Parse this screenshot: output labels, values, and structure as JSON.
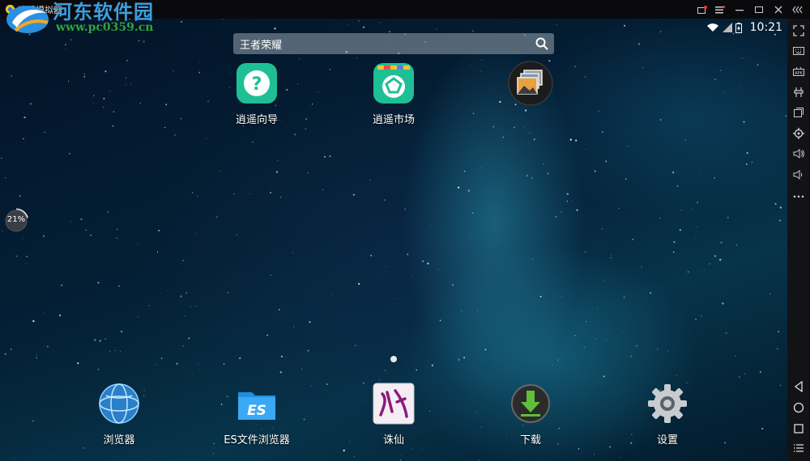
{
  "window": {
    "title": "逍遥模拟器"
  },
  "watermark": {
    "title": "河东软件园",
    "url": "www.pc0359.cn"
  },
  "status": {
    "time": "10:21"
  },
  "search": {
    "text": "王者荣耀"
  },
  "progress": {
    "percent": 21,
    "label": "21%"
  },
  "apps_top": [
    {
      "label": "逍遥向导",
      "icon": "help-icon",
      "color": "#1fbf95"
    },
    {
      "label": "逍遥市场",
      "icon": "market-icon",
      "color": "#1fbf95"
    },
    {
      "label": "",
      "icon": "gallery-icon",
      "color": "#222222"
    }
  ],
  "dock": [
    {
      "label": "浏览器",
      "icon": "browser-globe-icon"
    },
    {
      "label": "ES文件浏览器",
      "icon": "es-folder-icon"
    },
    {
      "label": "诛仙",
      "icon": "zhuxian-game-icon"
    },
    {
      "label": "下载",
      "icon": "download-icon"
    },
    {
      "label": "设置",
      "icon": "settings-gear-icon"
    }
  ],
  "colors": {
    "accent": "#1fbf95",
    "watermark_blue": "#3d9fe0",
    "watermark_green": "#2fa33a"
  }
}
